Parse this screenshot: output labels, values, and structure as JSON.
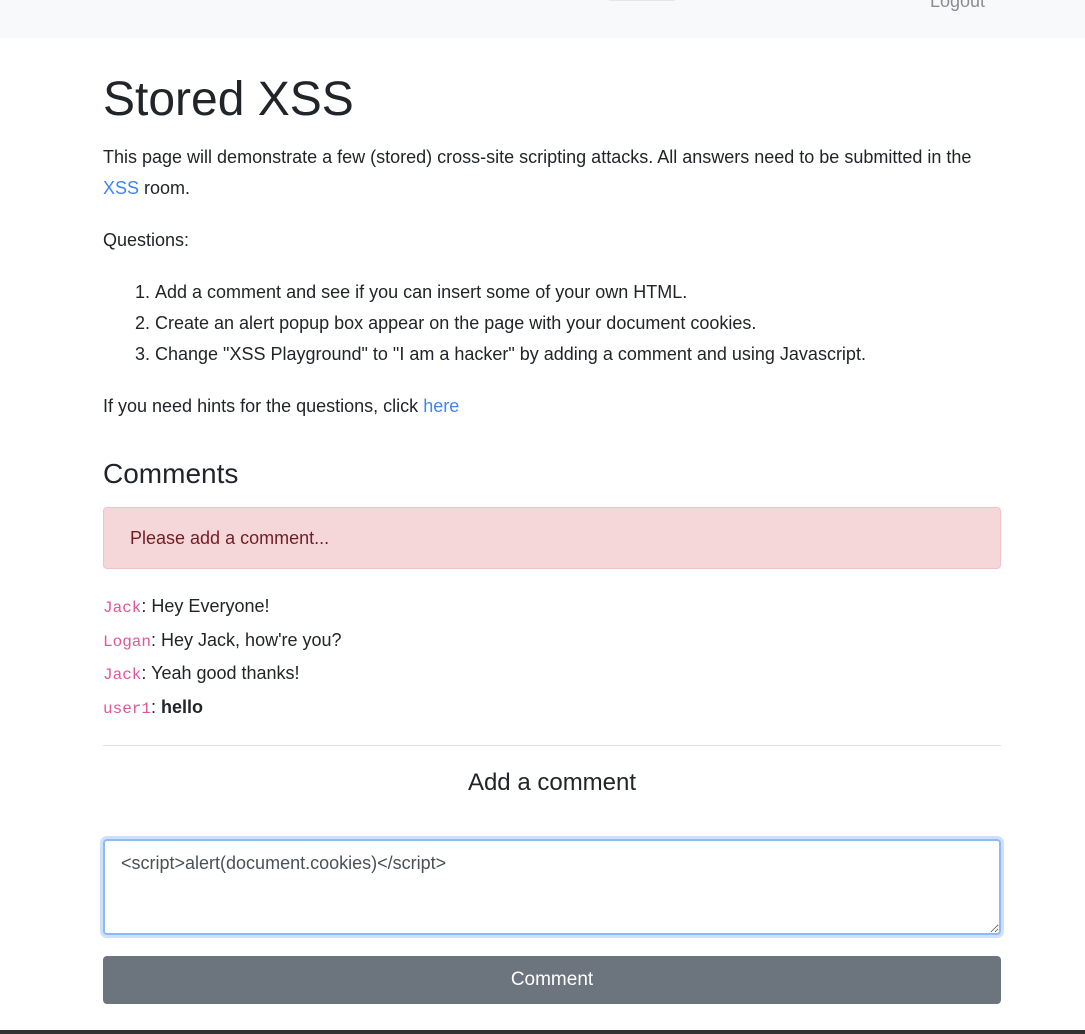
{
  "navbar": {
    "logout_label": "Logout"
  },
  "page": {
    "title": "Stored XSS",
    "intro_before": "This page will demonstrate a few (stored) cross-site scripting attacks. All answers need to be submitted in the ",
    "intro_link": "XSS",
    "intro_after": " room.",
    "questions_label": "Questions:",
    "questions": [
      "Add a comment and see if you can insert some of your own HTML.",
      "Create an alert popup box appear on the page with your document cookies.",
      "Change \"XSS Playground\" to \"I am a hacker\" by adding a comment and using Javascript."
    ],
    "hint_text": "If you need hints for the questions, click ",
    "hint_link": "here"
  },
  "comments": {
    "heading": "Comments",
    "alert": "Please add a comment...",
    "items": [
      {
        "user": "Jack",
        "text": "Hey Everyone!"
      },
      {
        "user": "Logan",
        "text": "Hey Jack, how're you?"
      },
      {
        "user": "Jack",
        "text": "Yeah good thanks!"
      },
      {
        "user": "user1",
        "text": "hello"
      }
    ]
  },
  "form": {
    "heading": "Add a comment",
    "value": "<script>alert(document.cookies)</script>",
    "submit_label": "Comment"
  }
}
